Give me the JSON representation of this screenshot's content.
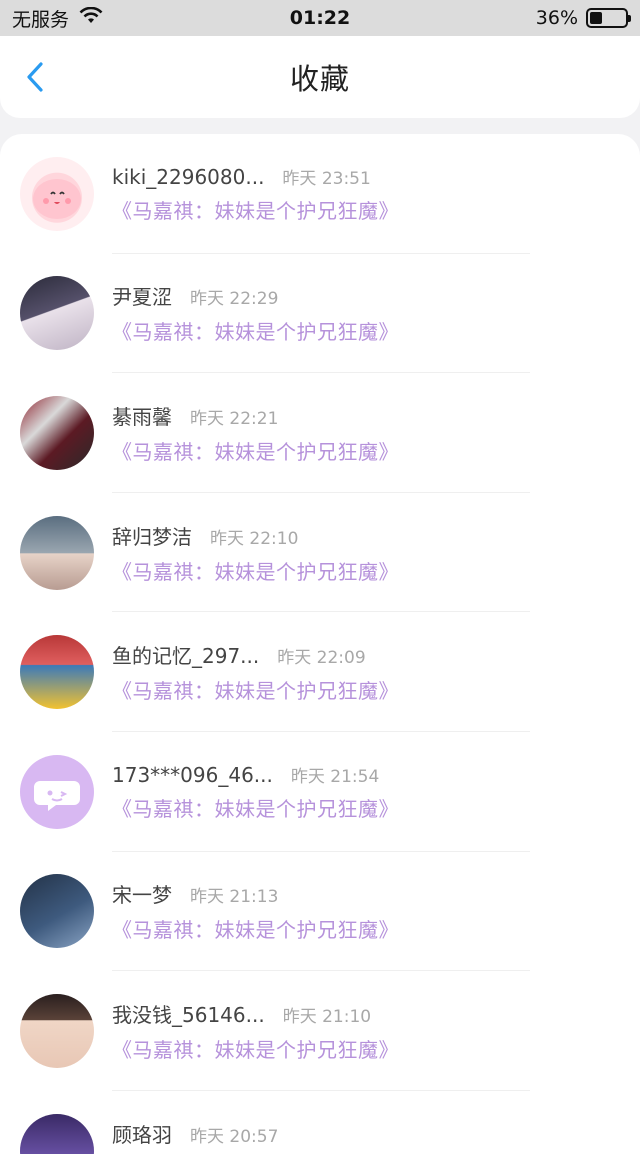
{
  "status_bar": {
    "carrier": "无服务",
    "time": "01:22",
    "battery_percent": "36%",
    "battery_level": 0.36
  },
  "header": {
    "title": "收藏",
    "back_icon": "chevron-left-icon"
  },
  "colors": {
    "accent_blue": "#2a9bf0",
    "title_purple": "#b692db",
    "time_gray": "#a8a8a8"
  },
  "items": [
    {
      "username": "kiki_2296080...",
      "time": "昨天 23:51",
      "work": "《马嘉祺：妹妹是个护兄狂魔》",
      "avatar": "cartoon-pink-avatar"
    },
    {
      "username": "尹夏涩",
      "time": "昨天 22:29",
      "work": "《马嘉祺：妹妹是个护兄狂魔》",
      "avatar": "photo-avatar"
    },
    {
      "username": "綦雨馨",
      "time": "昨天 22:21",
      "work": "《马嘉祺：妹妹是个护兄狂魔》",
      "avatar": "anime-avatar"
    },
    {
      "username": "辞归梦洁",
      "time": "昨天 22:10",
      "work": "《马嘉祺：妹妹是个护兄狂魔》",
      "avatar": "photo-avatar"
    },
    {
      "username": "鱼的记忆_297...",
      "time": "昨天 22:09",
      "work": "《马嘉祺：妹妹是个护兄狂魔》",
      "avatar": "photo-avatar"
    },
    {
      "username": "173***096_46...",
      "time": "昨天 21:54",
      "work": "《马嘉祺：妹妹是个护兄狂魔》",
      "avatar": "default-chat-avatar"
    },
    {
      "username": "宋一梦",
      "time": "昨天 21:13",
      "work": "《马嘉祺：妹妹是个护兄狂魔》",
      "avatar": "photo-avatar"
    },
    {
      "username": "我没钱_56146...",
      "time": "昨天 21:10",
      "work": "《马嘉祺：妹妹是个护兄狂魔》",
      "avatar": "photo-avatar"
    },
    {
      "username": "顾珞羽",
      "time": "昨天 20:57",
      "work": "《马嘉祺：妹妹是个护兄狂魔》",
      "avatar": "photo-avatar"
    }
  ]
}
